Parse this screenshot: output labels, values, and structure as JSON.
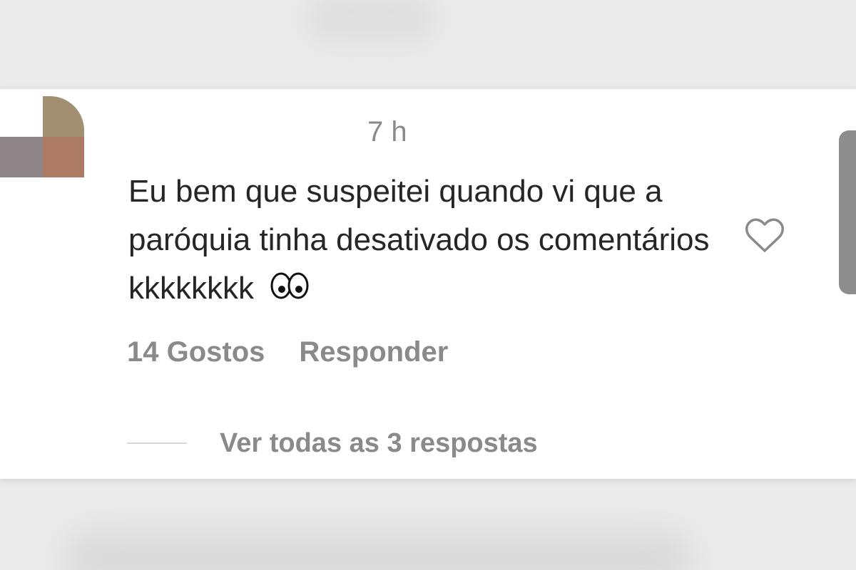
{
  "comment": {
    "time": "7 h",
    "text": "Eu bem que suspeitei quando vi que a paróquia tinha desativado os comentários kkkkkkkk",
    "emoji": "eyes-emoji",
    "likes_label": "14 Gostos",
    "reply_label": "Responder",
    "view_replies_label": "Ver todas as 3 respostas"
  },
  "icons": {
    "like": "heart-outline-icon",
    "emoji": "eyes-icon"
  },
  "colors": {
    "background": "#ebebeb",
    "card": "#ffffff",
    "text": "#262626",
    "muted": "#8a8a8a",
    "avatar_tan": "#a28f72",
    "avatar_gray": "#8e8588",
    "avatar_rust": "#ad7b63"
  }
}
